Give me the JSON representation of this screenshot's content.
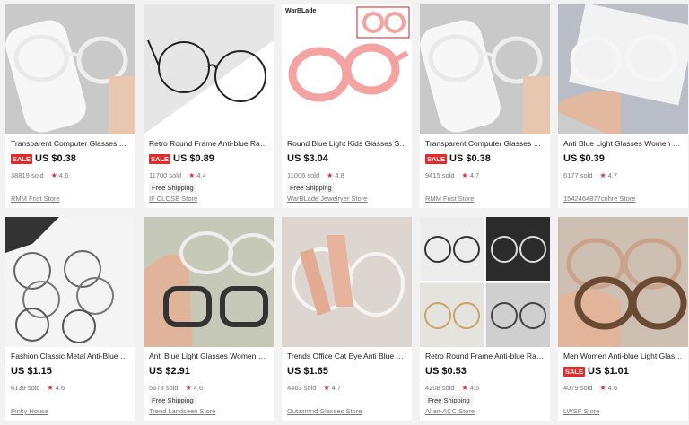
{
  "products": [
    {
      "title": "Transparent Computer Glasses Fra...",
      "sale": "SALE",
      "price": "US $0.38",
      "sold": "38819 sold",
      "rating": "4.6",
      "shipping": "",
      "store": "RMM Frist Store",
      "image": "clear-frame-on-white-case",
      "bg": "#c9c9c9"
    },
    {
      "title": "Retro Round Frame Anti-blue Radi...",
      "sale": "SALE",
      "price": "US $0.89",
      "sold": "11700 sold",
      "rating": "4.4",
      "shipping": "Free Shipping",
      "store": "IF CLOSE Store",
      "image": "black-round-frame",
      "bg": "#e6e6e6"
    },
    {
      "title": "Round Blue Light Kids Glasses Silic...",
      "sale": "",
      "price": "US $3.04",
      "sold": "11006 sold",
      "rating": "4.8",
      "shipping": "Free Shipping",
      "store": "WarBLade Jewelryer Store",
      "image": "pink-kids-frame",
      "bg": "#ffffff",
      "brand": "WarBLade"
    },
    {
      "title": "Transparent Computer Glasses Fra...",
      "sale": "SALE",
      "price": "US $0.38",
      "sold": "9415 sold",
      "rating": "4.7",
      "shipping": "",
      "store": "RMM Frist Store",
      "image": "clear-frame-on-white-case",
      "bg": "#c9c9c9"
    },
    {
      "title": "Anti Blue Light Glasses Women Vin...",
      "sale": "",
      "price": "US $0.39",
      "sold": "6177 sold",
      "rating": "4.7",
      "shipping": "",
      "store": "1542464877cnhre Store",
      "image": "clear-frame-hand",
      "bg": "#b8bdc6"
    },
    {
      "title": "Fashion Classic Metal Anti-Blue Lig...",
      "sale": "",
      "price": "US $1.15",
      "sold": "6139 sold",
      "rating": "4.6",
      "shipping": "",
      "store": "Pinky House",
      "image": "metal-frames-stack",
      "bg": "#f4f4f4"
    },
    {
      "title": "Anti Blue Light Glasses Women Vin...",
      "sale": "",
      "price": "US $2.91",
      "sold": "5679 sold",
      "rating": "4.6",
      "shipping": "Free Shipping",
      "store": "Trend Landseen Store",
      "image": "black-and-clear-frames",
      "bg": "#c7c9b8"
    },
    {
      "title": "Trends Office Cat Eye Anti Blue Lig...",
      "sale": "",
      "price": "US $1.65",
      "sold": "4463 sold",
      "rating": "4.7",
      "shipping": "",
      "store": "Outzzmnd Glasses Store",
      "image": "clear-frame-fingers",
      "bg": "#ddd5d0"
    },
    {
      "title": "Retro Round Frame Anti-blue Radi...",
      "sale": "",
      "price": "US $0.53",
      "sold": "4208 sold",
      "rating": "4.5",
      "shipping": "Free Shipping",
      "store": "Alian-ACC Store",
      "image": "round-frame-collage",
      "bg": "#dcdcdc"
    },
    {
      "title": "Men Women Anti-blue Light Glass...",
      "sale": "SALE",
      "price": "US $1.01",
      "sold": "4079 sold",
      "rating": "4.6",
      "shipping": "",
      "store": "LWSF Store",
      "image": "tortoise-frames-hand",
      "bg": "#cdbfb2"
    }
  ],
  "colors": {
    "sale": "#e32b2b",
    "star": "#e32b2b",
    "page_bg": "#f2f2f2"
  }
}
